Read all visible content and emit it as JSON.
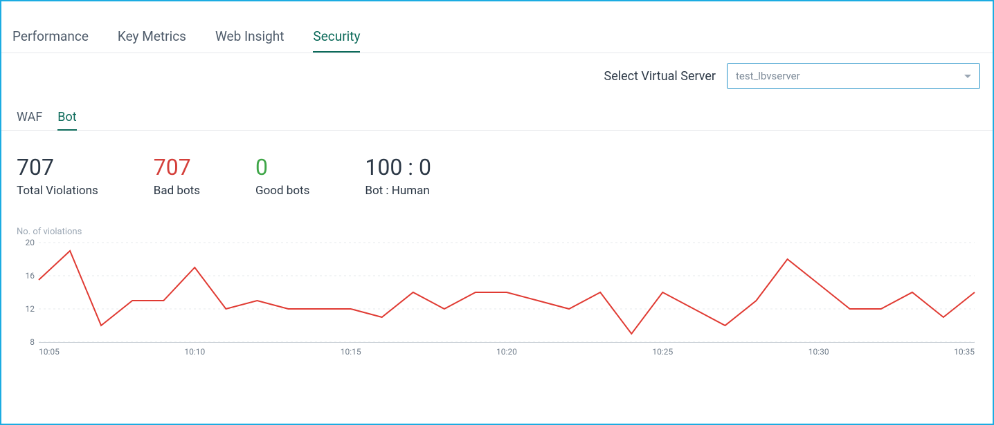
{
  "tabs": {
    "items": [
      "Performance",
      "Key Metrics",
      "Web Insight",
      "Security"
    ],
    "active": "Security"
  },
  "server_selector": {
    "label": "Select Virtual Server",
    "value": "test_lbvserver"
  },
  "subtabs": {
    "items": [
      "WAF",
      "Bot"
    ],
    "active": "Bot"
  },
  "stats": {
    "total_violations": {
      "value": "707",
      "label": "Total Violations"
    },
    "bad_bots": {
      "value": "707",
      "label": "Bad bots"
    },
    "good_bots": {
      "value": "0",
      "label": "Good bots"
    },
    "bot_human": {
      "value": "100 : 0",
      "label": "Bot : Human"
    }
  },
  "chart_data": {
    "type": "line",
    "title": "No. of violations",
    "xlabel": "",
    "ylabel": "",
    "ylim": [
      8,
      20
    ],
    "y_ticks": [
      8,
      12,
      16,
      20
    ],
    "x_tick_labels": [
      "10:05",
      "10:10",
      "10:15",
      "10:20",
      "10:25",
      "10:30",
      "10:35"
    ],
    "x": [
      "10:05",
      "10:06",
      "10:07",
      "10:08",
      "10:09",
      "10:10",
      "10:11",
      "10:12",
      "10:13",
      "10:14",
      "10:15",
      "10:16",
      "10:17",
      "10:18",
      "10:19",
      "10:20",
      "10:21",
      "10:22",
      "10:23",
      "10:24",
      "10:25",
      "10:26",
      "10:27",
      "10:28",
      "10:29",
      "10:30",
      "10:31",
      "10:32",
      "10:33",
      "10:34",
      "10:35"
    ],
    "series": [
      {
        "name": "Violations",
        "color": "#e03a32",
        "values": [
          15.5,
          19,
          10,
          13,
          13,
          17,
          12,
          13,
          12,
          12,
          12,
          11,
          14,
          12,
          14,
          14,
          13,
          12,
          14,
          9,
          14,
          12,
          10,
          13,
          18,
          15,
          12,
          12,
          14,
          11,
          14
        ]
      }
    ]
  }
}
